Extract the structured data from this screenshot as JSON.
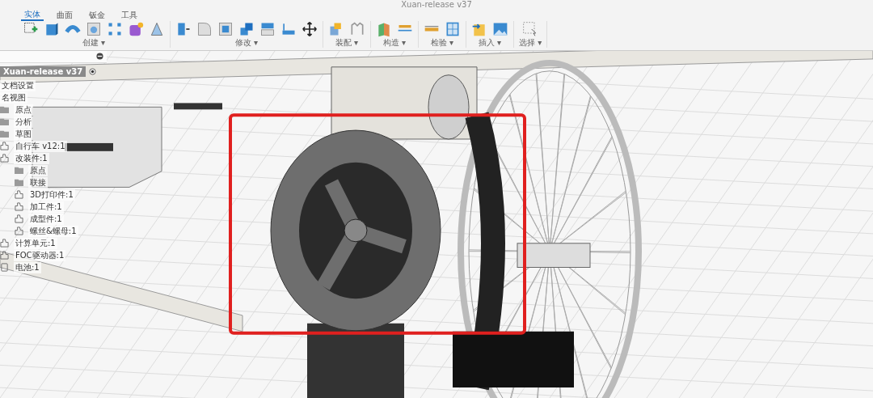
{
  "window": {
    "title": "Xuan-release v37"
  },
  "tabs": [
    {
      "label": "实体",
      "selected": true
    },
    {
      "label": "曲面",
      "selected": false
    },
    {
      "label": "钣金",
      "selected": false
    },
    {
      "label": "工具",
      "selected": false
    }
  ],
  "toolbar_groups": [
    {
      "label": "创建 ▾",
      "tools": [
        {
          "kind": "sketch"
        },
        {
          "kind": "box"
        },
        {
          "kind": "sweep"
        },
        {
          "kind": "hole"
        },
        {
          "kind": "pattern"
        },
        {
          "kind": "form"
        },
        {
          "kind": "loft"
        }
      ]
    },
    {
      "label": "修改 ▾",
      "tools": [
        {
          "kind": "press"
        },
        {
          "kind": "fillet"
        },
        {
          "kind": "shell"
        },
        {
          "kind": "combine"
        },
        {
          "kind": "split"
        },
        {
          "kind": "align"
        },
        {
          "kind": "move"
        }
      ]
    },
    {
      "label": "装配 ▾",
      "tools": [
        {
          "kind": "component"
        },
        {
          "kind": "joint"
        }
      ]
    },
    {
      "label": "构造 ▾",
      "tools": [
        {
          "kind": "plane"
        },
        {
          "kind": "midplane"
        }
      ]
    },
    {
      "label": "检验 ▾",
      "tools": [
        {
          "kind": "measure"
        },
        {
          "kind": "section"
        }
      ]
    },
    {
      "label": "插入 ▾",
      "tools": [
        {
          "kind": "insert"
        },
        {
          "kind": "canvas"
        }
      ]
    },
    {
      "label": "选择 ▾",
      "tools": [
        {
          "kind": "select"
        }
      ]
    }
  ],
  "browser": {
    "root": "Xuan-release v37",
    "items": [
      {
        "label": "文档设置",
        "kind": "setting"
      },
      {
        "label": "名视图",
        "kind": "setting"
      },
      {
        "label": "原点",
        "kind": "folder"
      },
      {
        "label": "分析",
        "kind": "folder"
      },
      {
        "label": "草图",
        "kind": "folder"
      },
      {
        "label": "自行车 v12:1",
        "kind": "component"
      },
      {
        "label": "改装件:1",
        "kind": "component",
        "children": [
          {
            "label": "原点",
            "kind": "folder"
          },
          {
            "label": "联接",
            "kind": "folder"
          },
          {
            "label": "3D打印件:1",
            "kind": "component"
          },
          {
            "label": "加工件:1",
            "kind": "component"
          },
          {
            "label": "成型件:1",
            "kind": "component"
          },
          {
            "label": "螺丝&螺母:1",
            "kind": "component"
          }
        ]
      },
      {
        "label": "计算单元:1",
        "kind": "component"
      },
      {
        "label": "FOC驱动器:1",
        "kind": "component"
      },
      {
        "label": "电池:1",
        "kind": "body"
      }
    ]
  }
}
